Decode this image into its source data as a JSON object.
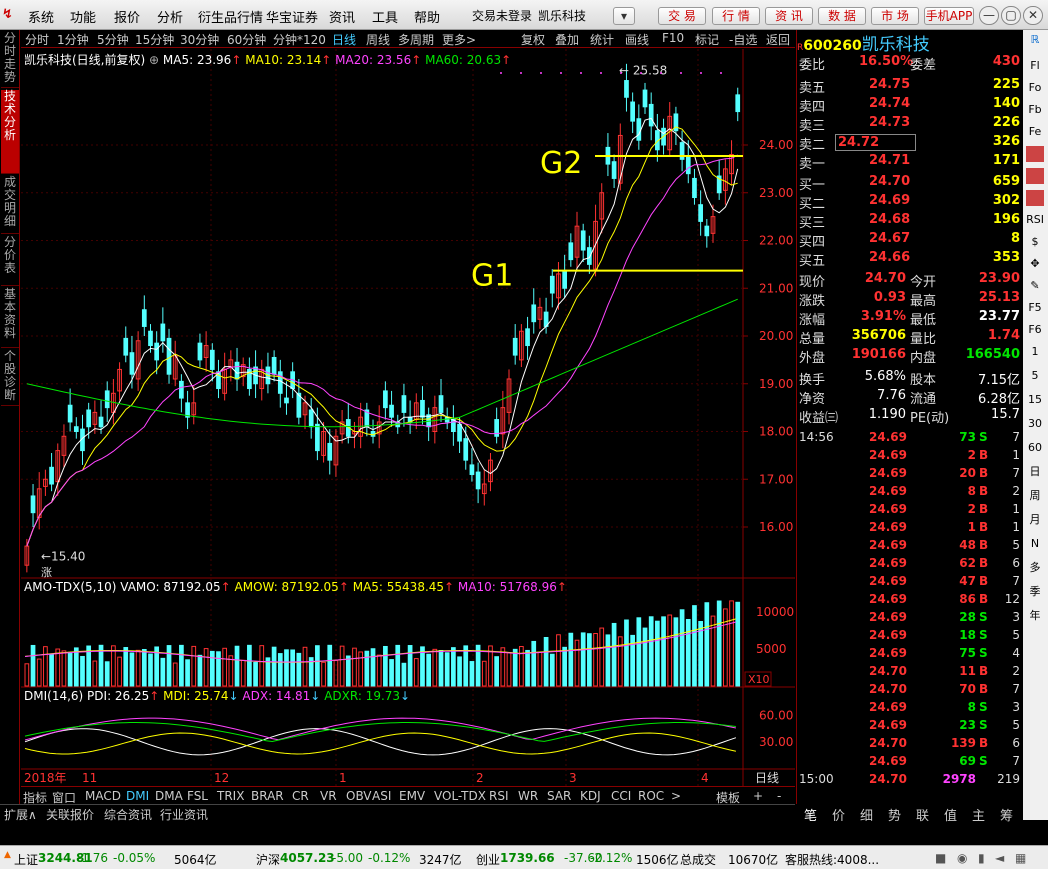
{
  "menu": {
    "items": [
      "系统",
      "功能",
      "报价",
      "分析",
      "衍生品行情",
      "华宝证券",
      "资讯",
      "工具",
      "帮助"
    ],
    "status": "交易未登录",
    "stock": "凯乐科技",
    "buttons": [
      "交 易",
      "行 情",
      "资 讯",
      "数 据",
      "市 场",
      "手机APP"
    ]
  },
  "lefttabs": [
    "分时走势",
    "技术分析",
    "成交明细",
    "分价表",
    "基本资料",
    "个股诊断"
  ],
  "periods": [
    "分时",
    "1分钟",
    "5分钟",
    "15分钟",
    "30分钟",
    "60分钟",
    "分钟*120",
    "日线",
    "周线",
    "多周期",
    "更多>"
  ],
  "periods_right": [
    "复权",
    "叠加",
    "统计",
    "画线",
    "F10",
    "标记",
    "-自选",
    "返回"
  ],
  "chart": {
    "title": "凯乐科技(日线,前复权)",
    "ma5": "MA5: 23.96",
    "ma10": "MA10: 23.14",
    "ma20": "MA20: 23.56",
    "ma60": "MA60: 20.63",
    "yticks": [
      "24.00",
      "23.00",
      "22.00",
      "21.00",
      "20.00",
      "19.00",
      "18.00",
      "17.00",
      "16.00"
    ],
    "high_label": "25.58",
    "low_label": "15.40",
    "g1": "G1",
    "g2": "G2",
    "zhang": "涨"
  },
  "vol": {
    "title": "AMO-TDX(5,10)",
    "vamo": "VAMO: 87192.05",
    "amow": "AMOW: 87192.05",
    "ma5": "MA5: 55438.45",
    "ma10": "MA10: 51768.96",
    "yticks": [
      "10000",
      "5000"
    ],
    "unit": "X10"
  },
  "dmi": {
    "title": "DMI(14,6)",
    "pdi": "PDI: 26.25",
    "mdi": "MDI: 25.74",
    "adx": "ADX: 14.81",
    "adxr": "ADXR: 19.73",
    "yticks": [
      "60.00",
      "30.00"
    ]
  },
  "xaxis": {
    "labels": [
      "2018年",
      "11",
      "12",
      "1",
      "2",
      "3",
      "4"
    ],
    "right": "日线"
  },
  "indtabs": [
    "指标",
    "窗口",
    "MACD",
    "DMI",
    "DMA",
    "FSL",
    "TRIX",
    "BRAR",
    "CR",
    "VR",
    "OBV",
    "ASI",
    "EMV",
    "VOL-TDX",
    "RSI",
    "WR",
    "SAR",
    "KDJ",
    "CCI",
    "ROC",
    ">",
    "模板",
    "+",
    "-"
  ],
  "bottomtabs": [
    "扩展∧",
    "关联报价",
    "综合资讯",
    "行业资讯"
  ],
  "quote": {
    "code": "600260",
    "name": "凯乐科技",
    "weibi_label": "委比",
    "weibi": "16.50%",
    "weicha_label": "委差",
    "weicha": "430",
    "sells": [
      {
        "l": "卖五",
        "p": "24.75",
        "v": "225"
      },
      {
        "l": "卖四",
        "p": "24.74",
        "v": "140"
      },
      {
        "l": "卖三",
        "p": "24.73",
        "v": "226"
      },
      {
        "l": "卖二",
        "p": "24.72",
        "v": "326"
      },
      {
        "l": "卖一",
        "p": "24.71",
        "v": "171"
      }
    ],
    "buys": [
      {
        "l": "买一",
        "p": "24.70",
        "v": "659"
      },
      {
        "l": "买二",
        "p": "24.69",
        "v": "302"
      },
      {
        "l": "买三",
        "p": "24.68",
        "v": "196"
      },
      {
        "l": "买四",
        "p": "24.67",
        "v": "8"
      },
      {
        "l": "买五",
        "p": "24.66",
        "v": "353"
      }
    ],
    "stats": [
      {
        "a": "现价",
        "b": "24.70",
        "c": "今开",
        "d": "23.90"
      },
      {
        "a": "涨跌",
        "b": "0.93",
        "c": "最高",
        "d": "25.13"
      },
      {
        "a": "涨幅",
        "b": "3.91%",
        "c": "最低",
        "d": "23.77"
      },
      {
        "a": "总量",
        "b": "356706",
        "c": "量比",
        "d": "1.74"
      },
      {
        "a": "外盘",
        "b": "190166",
        "c": "内盘",
        "d": "166540"
      }
    ],
    "stats2": [
      {
        "a": "换手",
        "b": "5.68%",
        "c": "股本",
        "d": "7.15亿"
      },
      {
        "a": "净资",
        "b": "7.76",
        "c": "流通",
        "d": "6.28亿"
      },
      {
        "a": "收益㈢",
        "b": "1.190",
        "c": "PE(动)",
        "d": "15.7"
      }
    ],
    "ticks": [
      {
        "t": "14:56",
        "p": "24.69",
        "v": "73",
        "s": "S",
        "n": "7"
      },
      {
        "t": "",
        "p": "24.69",
        "v": "2",
        "s": "B",
        "n": "1"
      },
      {
        "t": "",
        "p": "24.69",
        "v": "20",
        "s": "B",
        "n": "7"
      },
      {
        "t": "",
        "p": "24.69",
        "v": "8",
        "s": "B",
        "n": "2"
      },
      {
        "t": "",
        "p": "24.69",
        "v": "2",
        "s": "B",
        "n": "1"
      },
      {
        "t": "",
        "p": "24.69",
        "v": "1",
        "s": "B",
        "n": "1"
      },
      {
        "t": "",
        "p": "24.69",
        "v": "48",
        "s": "B",
        "n": "5"
      },
      {
        "t": "",
        "p": "24.69",
        "v": "62",
        "s": "B",
        "n": "6"
      },
      {
        "t": "",
        "p": "24.69",
        "v": "47",
        "s": "B",
        "n": "7"
      },
      {
        "t": "",
        "p": "24.69",
        "v": "86",
        "s": "B",
        "n": "12"
      },
      {
        "t": "",
        "p": "24.69",
        "v": "28",
        "s": "S",
        "n": "3"
      },
      {
        "t": "",
        "p": "24.69",
        "v": "18",
        "s": "S",
        "n": "5"
      },
      {
        "t": "",
        "p": "24.69",
        "v": "75",
        "s": "S",
        "n": "4"
      },
      {
        "t": "",
        "p": "24.70",
        "v": "11",
        "s": "B",
        "n": "2"
      },
      {
        "t": "",
        "p": "24.70",
        "v": "70",
        "s": "B",
        "n": "7"
      },
      {
        "t": "",
        "p": "24.69",
        "v": "8",
        "s": "S",
        "n": "3"
      },
      {
        "t": "",
        "p": "24.69",
        "v": "23",
        "s": "S",
        "n": "5"
      },
      {
        "t": "",
        "p": "24.70",
        "v": "139",
        "s": "B",
        "n": "6"
      },
      {
        "t": "",
        "p": "24.69",
        "v": "69",
        "s": "S",
        "n": "7"
      },
      {
        "t": "15:00",
        "p": "24.70",
        "v": "2978",
        "s": "",
        "n": "219"
      }
    ]
  },
  "rtabs": [
    "笔",
    "价",
    "细",
    "势",
    "联",
    "值",
    "主",
    "筹"
  ],
  "status": [
    {
      "n": "上证",
      "v": "3244.81",
      "c": "-1.76",
      "p": "-0.05%",
      "a": "5064亿"
    },
    {
      "n": "沪深",
      "v": "4057.23",
      "c": "-5.00",
      "p": "-0.12%",
      "a": "3247亿"
    },
    {
      "n": "创业",
      "v": "1739.66",
      "c": "-37.60",
      "p": "-2.12%",
      "a": "1506亿"
    }
  ],
  "status_extra": {
    "a": "总成交",
    "b": "10670亿",
    "c": "客服热线:4008..."
  },
  "rightbar": [
    "ℝ",
    "Fl",
    "Fo",
    "Fb",
    "Fe",
    "",
    "",
    "",
    "RSI",
    "$",
    "✥",
    "✎",
    "F5",
    "F6",
    "1",
    "5",
    "15",
    "30",
    "60",
    "日",
    "周",
    "月",
    "N",
    "多",
    "季",
    "年"
  ]
}
